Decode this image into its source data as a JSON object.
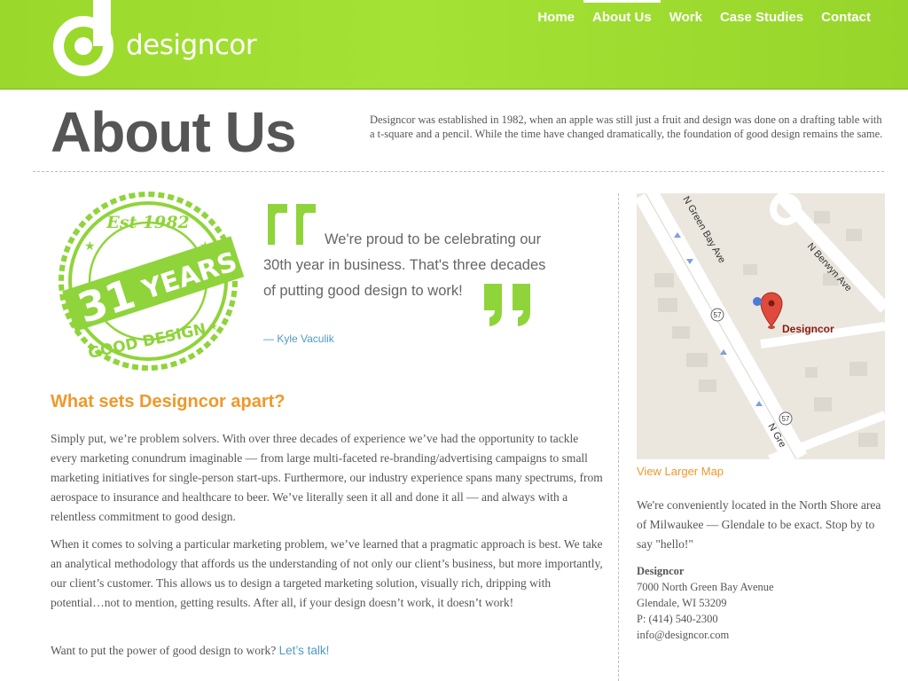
{
  "brand": {
    "logo_text": "designcor",
    "logo_icon": "designcor-d-logo"
  },
  "nav": {
    "items": [
      {
        "label": "Home",
        "active": false
      },
      {
        "label": "About Us",
        "active": true
      },
      {
        "label": "Work",
        "active": false
      },
      {
        "label": "Case Studies",
        "active": false
      },
      {
        "label": "Contact",
        "active": false
      }
    ]
  },
  "page": {
    "title": "About Us",
    "intro": "Designcor was established in 1982, when an apple was still just a fruit and design was done on a drafting table with a t-square and a pencil. While the time have changed dramatically, the foundation of good design remains the same."
  },
  "badge": {
    "est": "Est 1982",
    "number": "31",
    "years": "YEARS",
    "tagline": "GOOD DESIGN",
    "color": "#8fd43a"
  },
  "quote": {
    "line1": "We're proud to be celebrating our",
    "line2": "30th year in business. That's three decades",
    "line3": "of putting good design to work!",
    "author": "— Kyle Vaculik"
  },
  "main": {
    "heading": "What sets Designcor apart?",
    "paragraph1": "Simply put, we’re problem solvers. With over three decades of experience we’ve had the opportunity to tackle every marketing conundrum imaginable — from large multi-faceted re-branding/advertising campaigns to small marketing initiatives for single-person start-ups. Furthermore, our industry experience spans many spectrums, from aerospace to insurance and healthcare to beer. We’ve literally seen it all and done it all — and always with a relentless commitment to good design.",
    "paragraph2": "When it comes to solving a particular marketing problem, we’ve learned that a pragmatic approach is best. We take an analytical methodology that affords us the understanding of not only our client’s business, but more importantly, our client’s customer. This allows us to design a targeted marketing solution, visually rich, dripping with potential…not to mention, getting results. After all, if your design doesn’t work, it doesn’t work!",
    "cta_text": "Want to put the power of good design to work?",
    "cta_link": "Let’s talk!"
  },
  "sidebar": {
    "map": {
      "road_main": "N Green Bay Ave",
      "road_main_bottom": "N Gre",
      "road_side": "N Berwyn Ave",
      "route_number": "57",
      "pin_label": "Designcor"
    },
    "map_link": "View Larger Map",
    "location_text": "We're conveniently located in the North Shore area of Milwaukee — Glendale to be exact. Stop by to say \"hello!\"",
    "address": {
      "name": "Designcor",
      "street": "7000 North Green Bay Avenue",
      "city": "Glendale, WI 53209",
      "phone": "P: (414) 540-2300",
      "email": "info@designcor.com"
    }
  },
  "colors": {
    "header_green": "#a5e236",
    "accent_orange": "#f0982b",
    "link_blue": "#4e9ac4"
  }
}
